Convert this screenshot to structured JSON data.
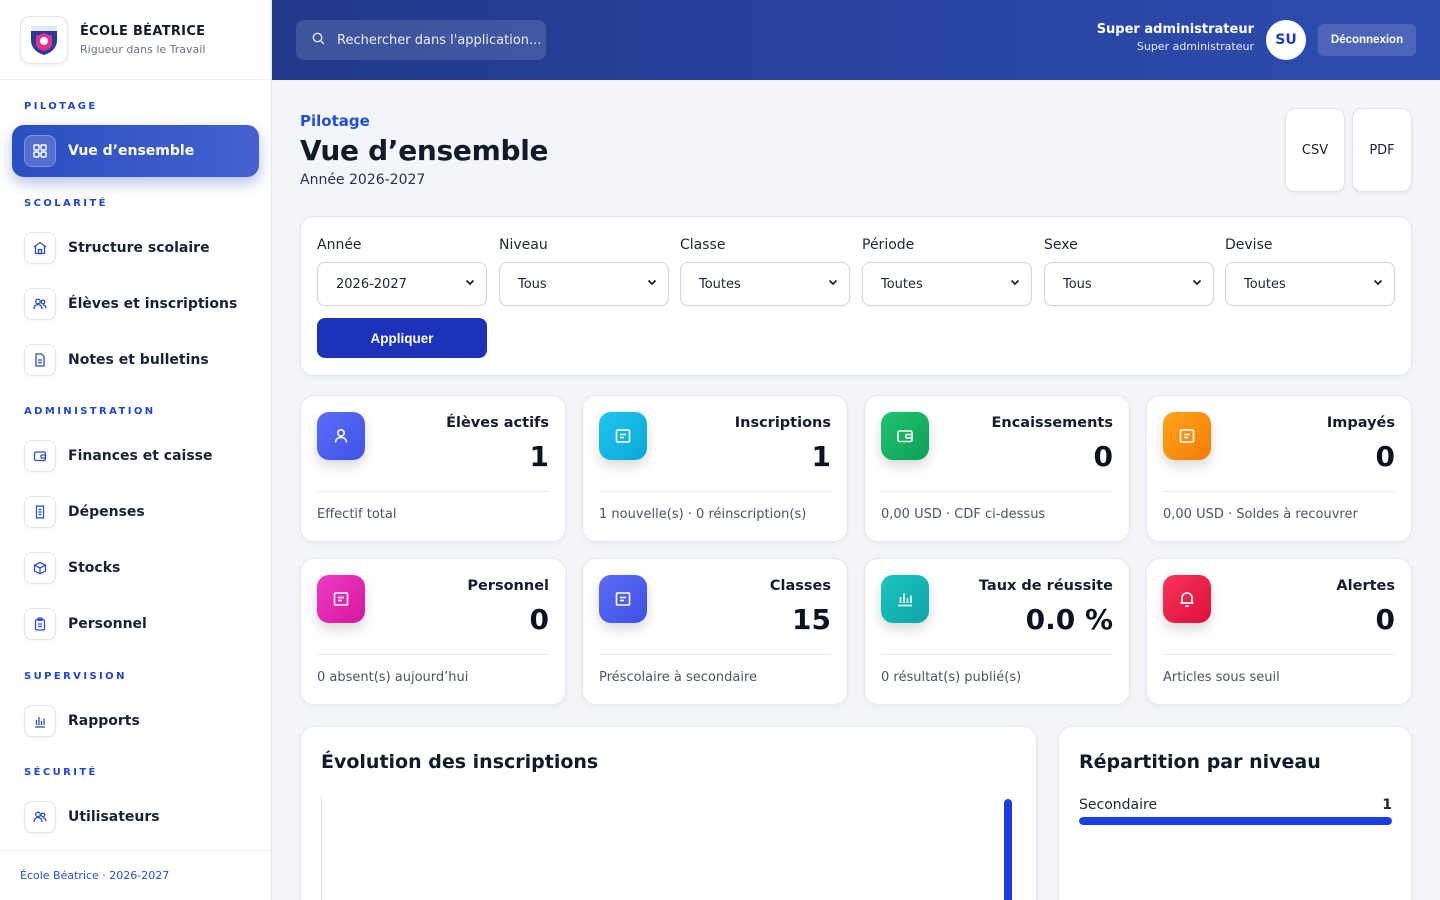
{
  "brand": {
    "name": "ÉCOLE BÉATRICE",
    "tagline": "Rigueur dans le Travail"
  },
  "sidebar": {
    "sections": [
      {
        "label": "PILOTAGE"
      },
      {
        "label": "SCOLARITÉ"
      },
      {
        "label": "ADMINISTRATION"
      },
      {
        "label": "SUPERVISION"
      },
      {
        "label": "SÉCURITÉ"
      }
    ],
    "items": [
      {
        "label": "Vue d’ensemble",
        "icon": "grid-icon",
        "active": true
      },
      {
        "label": "Structure scolaire",
        "icon": "school-icon"
      },
      {
        "label": "Élèves et inscriptions",
        "icon": "users-icon"
      },
      {
        "label": "Notes et bulletins",
        "icon": "document-icon"
      },
      {
        "label": "Finances et caisse",
        "icon": "wallet-icon"
      },
      {
        "label": "Dépenses",
        "icon": "receipt-icon"
      },
      {
        "label": "Stocks",
        "icon": "box-icon"
      },
      {
        "label": "Personnel",
        "icon": "clipboard-icon"
      },
      {
        "label": "Rapports",
        "icon": "bar-chart-icon"
      },
      {
        "label": "Utilisateurs",
        "icon": "users-icon"
      }
    ],
    "footer": "École Béatrice · 2026-2027"
  },
  "topbar": {
    "search_placeholder": "Rechercher dans l'application...",
    "user_name": "Super administrateur",
    "user_role": "Super administrateur",
    "avatar_initials": "SU",
    "logout_label": "Déconnexion"
  },
  "header": {
    "breadcrumb": "Pilotage",
    "title": "Vue d’ensemble",
    "subtitle": "Année 2026-2027",
    "export_csv": "CSV",
    "export_pdf": "PDF"
  },
  "filters": {
    "fields": [
      {
        "label": "Année",
        "value": "2026-2027"
      },
      {
        "label": "Niveau",
        "value": "Tous"
      },
      {
        "label": "Classe",
        "value": "Toutes"
      },
      {
        "label": "Période",
        "value": "Toutes"
      },
      {
        "label": "Sexe",
        "value": "Tous"
      },
      {
        "label": "Devise",
        "value": "Toutes"
      }
    ],
    "apply_label": "Appliquer"
  },
  "stats": [
    {
      "title": "Élèves actifs",
      "value": "1",
      "foot": "Effectif total",
      "icon": "user-icon",
      "color": "#4f63f3"
    },
    {
      "title": "Inscriptions",
      "value": "1",
      "foot": "1 nouvelle(s) · 0 réinscription(s)",
      "icon": "form-icon",
      "color": "#0fb8e6"
    },
    {
      "title": "Encaissements",
      "value": "0",
      "foot": "0,00 USD · CDF ci-dessus",
      "icon": "wallet-icon",
      "color": "#14b266"
    },
    {
      "title": "Impayés",
      "value": "0",
      "foot": "0,00 USD · Soldes à recouvrer",
      "icon": "form-icon",
      "color": "#f7900c"
    },
    {
      "title": "Personnel",
      "value": "0",
      "foot": "0 absent(s) aujourd’hui",
      "icon": "form-icon",
      "color": "#e427b3"
    },
    {
      "title": "Classes",
      "value": "15",
      "foot": "Préscolaire à secondaire",
      "icon": "form-icon",
      "color": "#4f5ff0"
    },
    {
      "title": "Taux de réussite",
      "value": "0.0 %",
      "foot": "0 résultat(s) publié(s)",
      "icon": "bar-chart-icon",
      "color": "#12b5b0"
    },
    {
      "title": "Alertes",
      "value": "0",
      "foot": "Articles sous seuil",
      "icon": "bell-icon",
      "color": "#ee1f4a"
    }
  ],
  "chart": {
    "title": "Évolution des inscriptions"
  },
  "chart_data": {
    "type": "bar",
    "categories": [
      "",
      ""
    ],
    "values": [
      0,
      1
    ],
    "title": "Évolution des inscriptions",
    "xlabel": "",
    "ylabel": ""
  },
  "distribution": {
    "title": "Répartition par niveau",
    "rows": [
      {
        "label": "Secondaire",
        "value": "1",
        "fraction": 1.0
      }
    ]
  }
}
